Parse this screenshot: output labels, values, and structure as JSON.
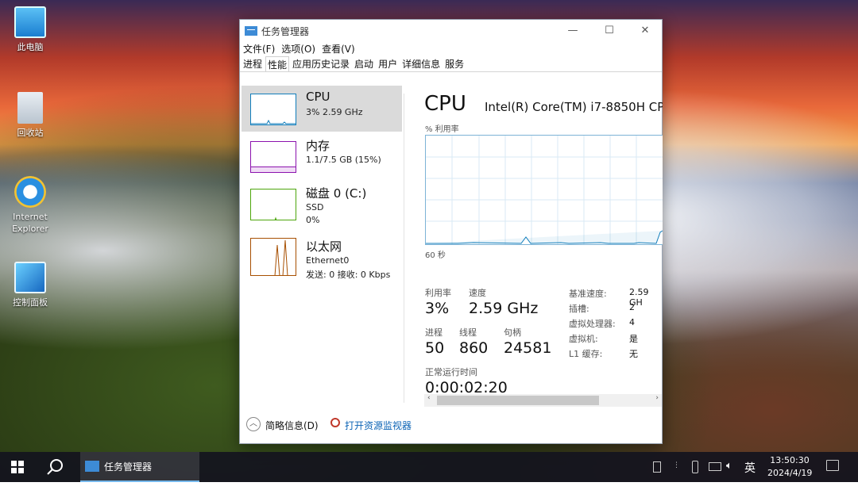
{
  "desktop": {
    "icons": [
      {
        "label": "此电脑"
      },
      {
        "label": "回收站"
      },
      {
        "label": "Internet Explorer"
      },
      {
        "label": "控制面板"
      }
    ]
  },
  "window": {
    "title": "任务管理器",
    "minimize": "—",
    "maximize": "☐",
    "close": "✕"
  },
  "menu": [
    "文件(F)",
    "选项(O)",
    "查看(V)"
  ],
  "tabs": [
    "进程",
    "性能",
    "应用历史记录",
    "启动",
    "用户",
    "详细信息",
    "服务"
  ],
  "left_items": [
    {
      "title": "CPU",
      "sub1": "3%  2.59 GHz",
      "color": "#117dbb"
    },
    {
      "title": "内存",
      "sub1": "1.1/7.5 GB (15%)",
      "color": "#8b12ae"
    },
    {
      "title": "磁盘 0 (C:)",
      "sub1": "SSD",
      "sub2": "0%",
      "color": "#4da60c"
    },
    {
      "title": "以太网",
      "sub1": "Ethernet0",
      "sub2": "发送: 0  接收: 0 Kbps",
      "color": "#a74f01"
    }
  ],
  "detail": {
    "title": "CPU",
    "cpu_name": "Intel(R) Core(TM) i7-8850H CP",
    "graph_label_top": "% 利用率",
    "graph_label_bottom": "60 秒",
    "util_label": "利用率",
    "util_value": "3%",
    "speed_label": "速度",
    "speed_value": "2.59 GHz",
    "proc_label": "进程",
    "proc_value": "50",
    "thread_label": "线程",
    "thread_value": "860",
    "handle_label": "句柄",
    "handle_value": "24581",
    "uptime_label": "正常运行时间",
    "uptime_value": "0:00:02:20",
    "kv": [
      [
        "基准速度:",
        "2.59 GH"
      ],
      [
        "插槽:",
        "2"
      ],
      [
        "虚拟处理器:",
        "4"
      ],
      [
        "虚拟机:",
        "是"
      ],
      [
        "L1 缓存:",
        "无"
      ]
    ]
  },
  "footer": {
    "brief": "简略信息(D)",
    "monitor": "打开资源监视器"
  },
  "taskbar": {
    "app": "任务管理器",
    "ime": "英",
    "time": "13:50:30",
    "date": "2024/4/19"
  }
}
